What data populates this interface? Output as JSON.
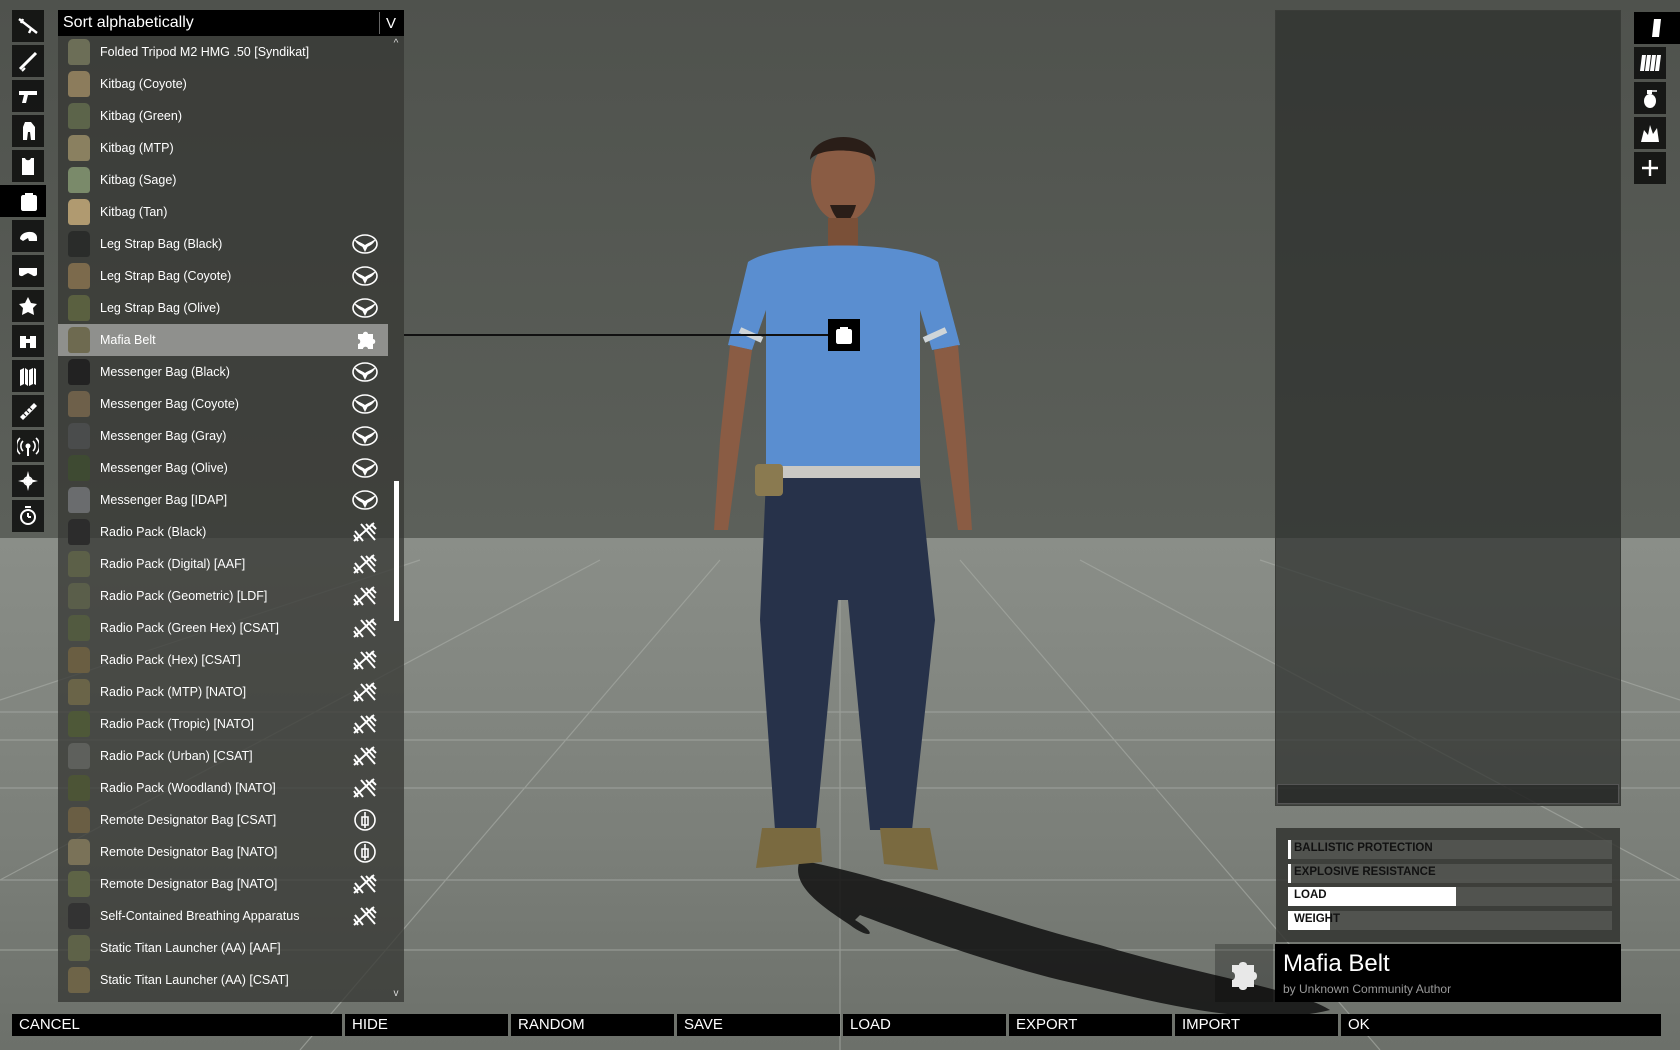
{
  "sort": {
    "label": "Sort alphabetically",
    "chevron": "V"
  },
  "categories": [
    {
      "name": "primary-weapon-icon",
      "active": false
    },
    {
      "name": "launcher-icon",
      "active": false
    },
    {
      "name": "handgun-icon",
      "active": false
    },
    {
      "name": "uniform-icon",
      "active": false
    },
    {
      "name": "vest-icon",
      "active": false
    },
    {
      "name": "backpack-icon",
      "active": true
    },
    {
      "name": "helmet-icon",
      "active": false
    },
    {
      "name": "goggles-icon",
      "active": false
    },
    {
      "name": "insignia-icon",
      "active": false
    },
    {
      "name": "binoculars-icon",
      "active": false
    },
    {
      "name": "map-icon",
      "active": false
    },
    {
      "name": "gps-icon",
      "active": false
    },
    {
      "name": "radio-icon",
      "active": false
    },
    {
      "name": "compass-icon",
      "active": false
    },
    {
      "name": "watch-icon",
      "active": false
    }
  ],
  "items": [
    {
      "name": "Folded Tripod M2 HMG .50 [Syndikat]",
      "thumb": "#6c6e57",
      "dlc": ""
    },
    {
      "name": "Kitbag (Coyote)",
      "thumb": "#8c7c5c",
      "dlc": ""
    },
    {
      "name": "Kitbag (Green)",
      "thumb": "#5c644a",
      "dlc": ""
    },
    {
      "name": "Kitbag (MTP)",
      "thumb": "#8a8060",
      "dlc": ""
    },
    {
      "name": "Kitbag (Sage)",
      "thumb": "#7a8a6a",
      "dlc": ""
    },
    {
      "name": "Kitbag (Tan)",
      "thumb": "#b09a70",
      "dlc": ""
    },
    {
      "name": "Leg Strap Bag (Black)",
      "thumb": "#2a2c2a",
      "dlc": "wings-dlc-icon"
    },
    {
      "name": "Leg Strap Bag (Coyote)",
      "thumb": "#7c6a4c",
      "dlc": "wings-dlc-icon"
    },
    {
      "name": "Leg Strap Bag (Olive)",
      "thumb": "#5a6040",
      "dlc": "wings-dlc-icon"
    },
    {
      "name": "Mafia Belt",
      "thumb": "#6e6a50",
      "dlc": "puzzle-icon",
      "selected": true
    },
    {
      "name": "Messenger Bag (Black)",
      "thumb": "#222",
      "dlc": "wings-dlc-icon"
    },
    {
      "name": "Messenger Bag (Coyote)",
      "thumb": "#6e604a",
      "dlc": "wings-dlc-icon"
    },
    {
      "name": "Messenger Bag (Gray)",
      "thumb": "#4a4c4c",
      "dlc": "wings-dlc-icon"
    },
    {
      "name": "Messenger Bag (Olive)",
      "thumb": "#3e4a32",
      "dlc": "wings-dlc-icon"
    },
    {
      "name": "Messenger Bag [IDAP]",
      "thumb": "#6a6c6e",
      "dlc": "wings-dlc-icon"
    },
    {
      "name": "Radio Pack (Black)",
      "thumb": "#2c2c2c",
      "dlc": "contact-dlc-icon"
    },
    {
      "name": "Radio Pack (Digital) [AAF]",
      "thumb": "#5c6048",
      "dlc": "contact-dlc-icon"
    },
    {
      "name": "Radio Pack (Geometric) [LDF]",
      "thumb": "#5a5e4a",
      "dlc": "contact-dlc-icon"
    },
    {
      "name": "Radio Pack (Green Hex) [CSAT]",
      "thumb": "#525a40",
      "dlc": "contact-dlc-icon"
    },
    {
      "name": "Radio Pack (Hex) [CSAT]",
      "thumb": "#6a5e42",
      "dlc": "contact-dlc-icon"
    },
    {
      "name": "Radio Pack (MTP) [NATO]",
      "thumb": "#6a6448",
      "dlc": "contact-dlc-icon"
    },
    {
      "name": "Radio Pack (Tropic) [NATO]",
      "thumb": "#4e5838",
      "dlc": "contact-dlc-icon"
    },
    {
      "name": "Radio Pack (Urban) [CSAT]",
      "thumb": "#5e605c",
      "dlc": "contact-dlc-icon"
    },
    {
      "name": "Radio Pack (Woodland) [NATO]",
      "thumb": "#4c5436",
      "dlc": "contact-dlc-icon"
    },
    {
      "name": "Remote Designator Bag [CSAT]",
      "thumb": "#6a5e44",
      "dlc": "rifle-dlc-icon"
    },
    {
      "name": "Remote Designator Bag [NATO]",
      "thumb": "#7a7258",
      "dlc": "rifle-dlc-icon"
    },
    {
      "name": "Remote Designator Bag [NATO]",
      "thumb": "#5e6446",
      "dlc": "contact-dlc-icon"
    },
    {
      "name": "Self-Contained Breathing Apparatus",
      "thumb": "#333",
      "dlc": "contact-dlc-icon"
    },
    {
      "name": "Static Titan Launcher (AA) [AAF]",
      "thumb": "#5e6248",
      "dlc": ""
    },
    {
      "name": "Static Titan Launcher (AA) [CSAT]",
      "thumb": "#6e6448",
      "dlc": ""
    },
    {
      "name": "",
      "thumb": "transparent",
      "dlc": "contact-dlc-icon"
    }
  ],
  "scroll": {
    "up": "^",
    "down": "v",
    "position": 0.54,
    "visible_fraction": 0.15
  },
  "right_tabs": [
    {
      "name": "magazine-icon",
      "active": true
    },
    {
      "name": "multi-magazine-icon",
      "active": false
    },
    {
      "name": "grenade-icon",
      "active": false
    },
    {
      "name": "explosive-icon",
      "active": false
    },
    {
      "name": "add-icon",
      "active": false
    }
  ],
  "stats": [
    {
      "label": "BALLISTIC PROTECTION",
      "value": 0
    },
    {
      "label": "EXPLOSIVE RESISTANCE",
      "value": 0
    },
    {
      "label": "LOAD",
      "value": 0.52
    },
    {
      "label": "WEIGHT",
      "value": 0.13
    }
  ],
  "info": {
    "title": "Mafia Belt",
    "author": "by Unknown Community Author"
  },
  "buttons": [
    "CANCEL",
    "HIDE",
    "RANDOM",
    "SAVE",
    "LOAD",
    "EXPORT",
    "IMPORT",
    "OK"
  ]
}
